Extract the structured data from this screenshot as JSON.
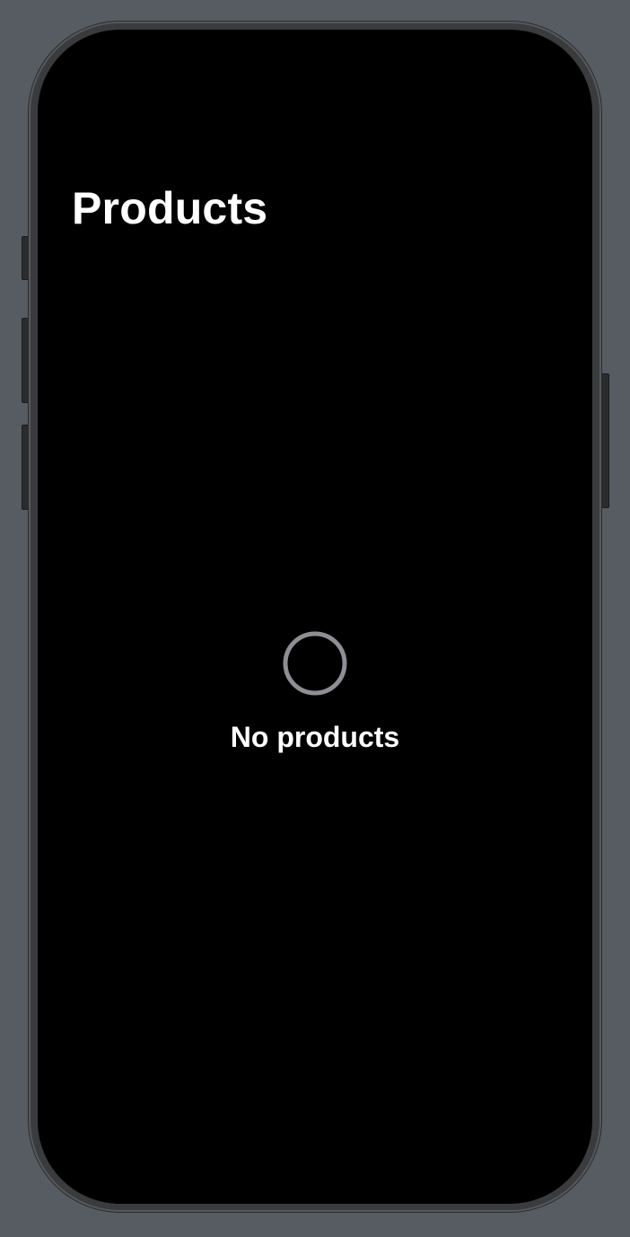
{
  "navigation": {
    "title": "Products"
  },
  "empty_state": {
    "icon": "circle-outline-icon",
    "message": "No products",
    "icon_color": "#8e8e93"
  },
  "device": {
    "screen_color": "#000000",
    "backdrop_color": "#575c63"
  }
}
